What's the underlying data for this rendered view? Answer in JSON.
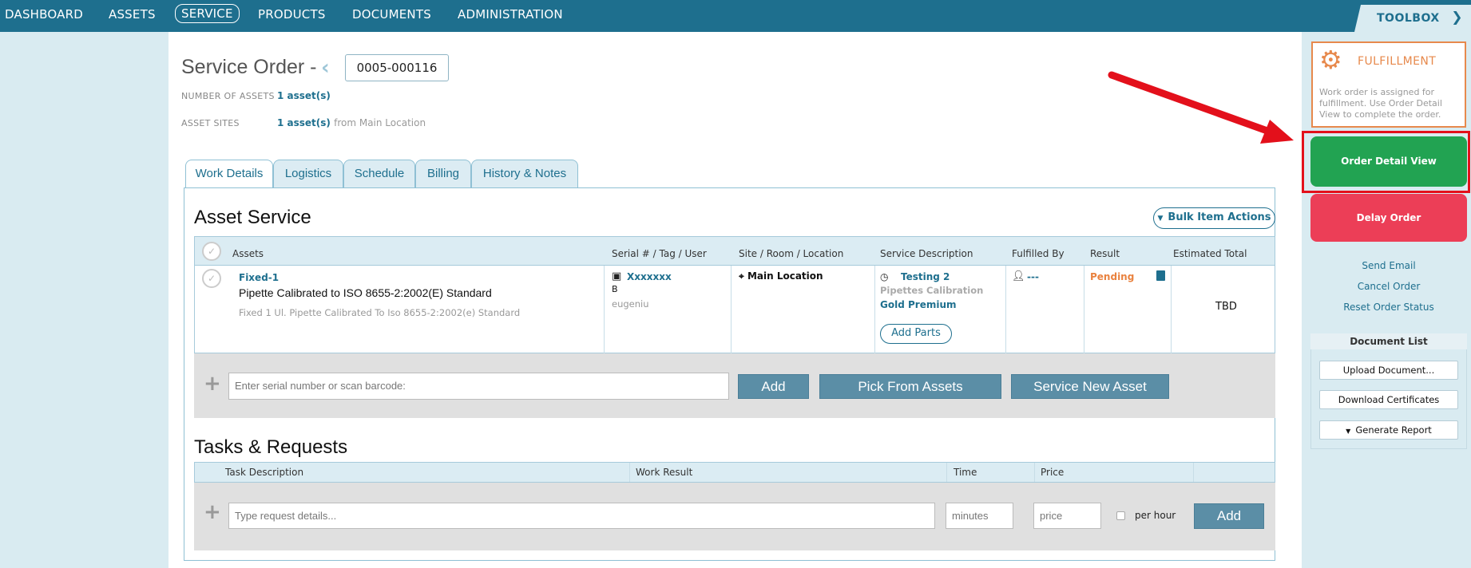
{
  "nav": {
    "items": [
      "DASHBOARD",
      "ASSETS",
      "SERVICE",
      "PRODUCTS",
      "DOCUMENTS",
      "ADMINISTRATION"
    ],
    "active": "SERVICE",
    "toolbox_label": "TOOLBOX"
  },
  "header": {
    "title": "Service Order -",
    "order_number": "0005-000116",
    "num_assets_label": "NUMBER OF ASSETS",
    "num_assets_value": "1 asset(s)",
    "asset_sites_label": "ASSET SITES",
    "asset_sites_value": "1 asset(s)",
    "asset_sites_suffix": "from Main Location"
  },
  "tabs": [
    "Work Details",
    "Logistics",
    "Schedule",
    "Billing",
    "History & Notes"
  ],
  "asset_service": {
    "title": "Asset Service",
    "bulk_button": "Bulk Item Actions",
    "columns": [
      "Assets",
      "Serial # / Tag / User",
      "Site / Room / Location",
      "Service Description",
      "Fulfilled By",
      "Result",
      "Estimated Total"
    ],
    "row": {
      "asset_id": "Fixed-1",
      "asset_name": "Pipette Calibrated to ISO 8655-2:2002(E) Standard",
      "asset_desc": "Fixed 1 Ul. Pipette Calibrated To Iso 8655-2:2002(e) Standard",
      "serial": "Xxxxxxx",
      "tag": "B",
      "user": "eugeniu",
      "location": "Main Location",
      "service_name": "Testing 2",
      "service_type": "Pipettes Calibration",
      "service_plan": "Gold Premium",
      "add_parts": "Add Parts",
      "fulfilled_by": "---",
      "result": "Pending",
      "estimated_total": "TBD"
    },
    "serial_placeholder": "Enter serial number or scan barcode:",
    "add_button": "Add",
    "pick_button": "Pick From Assets",
    "new_asset_button": "Service New Asset"
  },
  "tasks": {
    "title": "Tasks & Requests",
    "columns": [
      "Task Description",
      "Work Result",
      "Time",
      "Price"
    ],
    "request_placeholder": "Type request details...",
    "minutes_placeholder": "minutes",
    "price_placeholder": "price",
    "per_hour_label": "per hour",
    "add_button": "Add"
  },
  "sidebar": {
    "fulfillment_title": "FULFILLMENT",
    "fulfillment_text": "Work order is assigned for fulfillment. Use Order Detail View to complete the order.",
    "order_detail_button": "Order Detail View",
    "delay_button": "Delay Order",
    "links": [
      "Send Email",
      "Cancel Order",
      "Reset Order Status"
    ],
    "doc_list_title": "Document List",
    "doc_buttons": [
      "Upload Document...",
      "Download Certificates",
      "Generate Report"
    ]
  },
  "colors": {
    "nav_bg": "#1e6f8e",
    "accent": "#1e6f8e",
    "order_detail_green": "#22a352",
    "delay_red": "#ec3e57",
    "highlight_red": "#e3101b",
    "fulfillment_orange": "#e7894c",
    "pending_orange": "#e9823f"
  }
}
